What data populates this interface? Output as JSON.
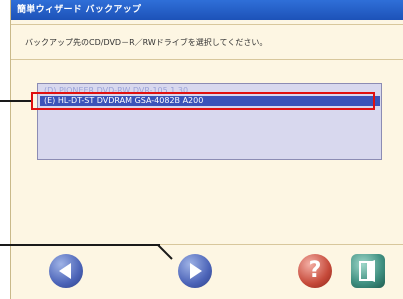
{
  "window": {
    "title": "簡単ウィザード バックアップ",
    "instruction": "バックアップ先のCD/DVD－R／RWドライブを選択してください。"
  },
  "drive_list": {
    "items": [
      {
        "label": "(D) PIONEER  DVD-RW  DVR-105  1.30",
        "selected": false
      },
      {
        "label": "(E) HL-DT-ST DVDRAM GSA-4082B A200",
        "selected": true
      }
    ]
  },
  "buttons": {
    "back_icon": "back-arrow-icon",
    "next_icon": "next-arrow-icon",
    "help_icon": "help-question-icon",
    "close_icon": "close-exit-icon"
  },
  "colors": {
    "titlebar": "#1d52b8",
    "selection": "#3b53b9",
    "highlight": "#e01010",
    "list_bg": "#d8d8ee",
    "window_bg": "#fdf6e3"
  }
}
